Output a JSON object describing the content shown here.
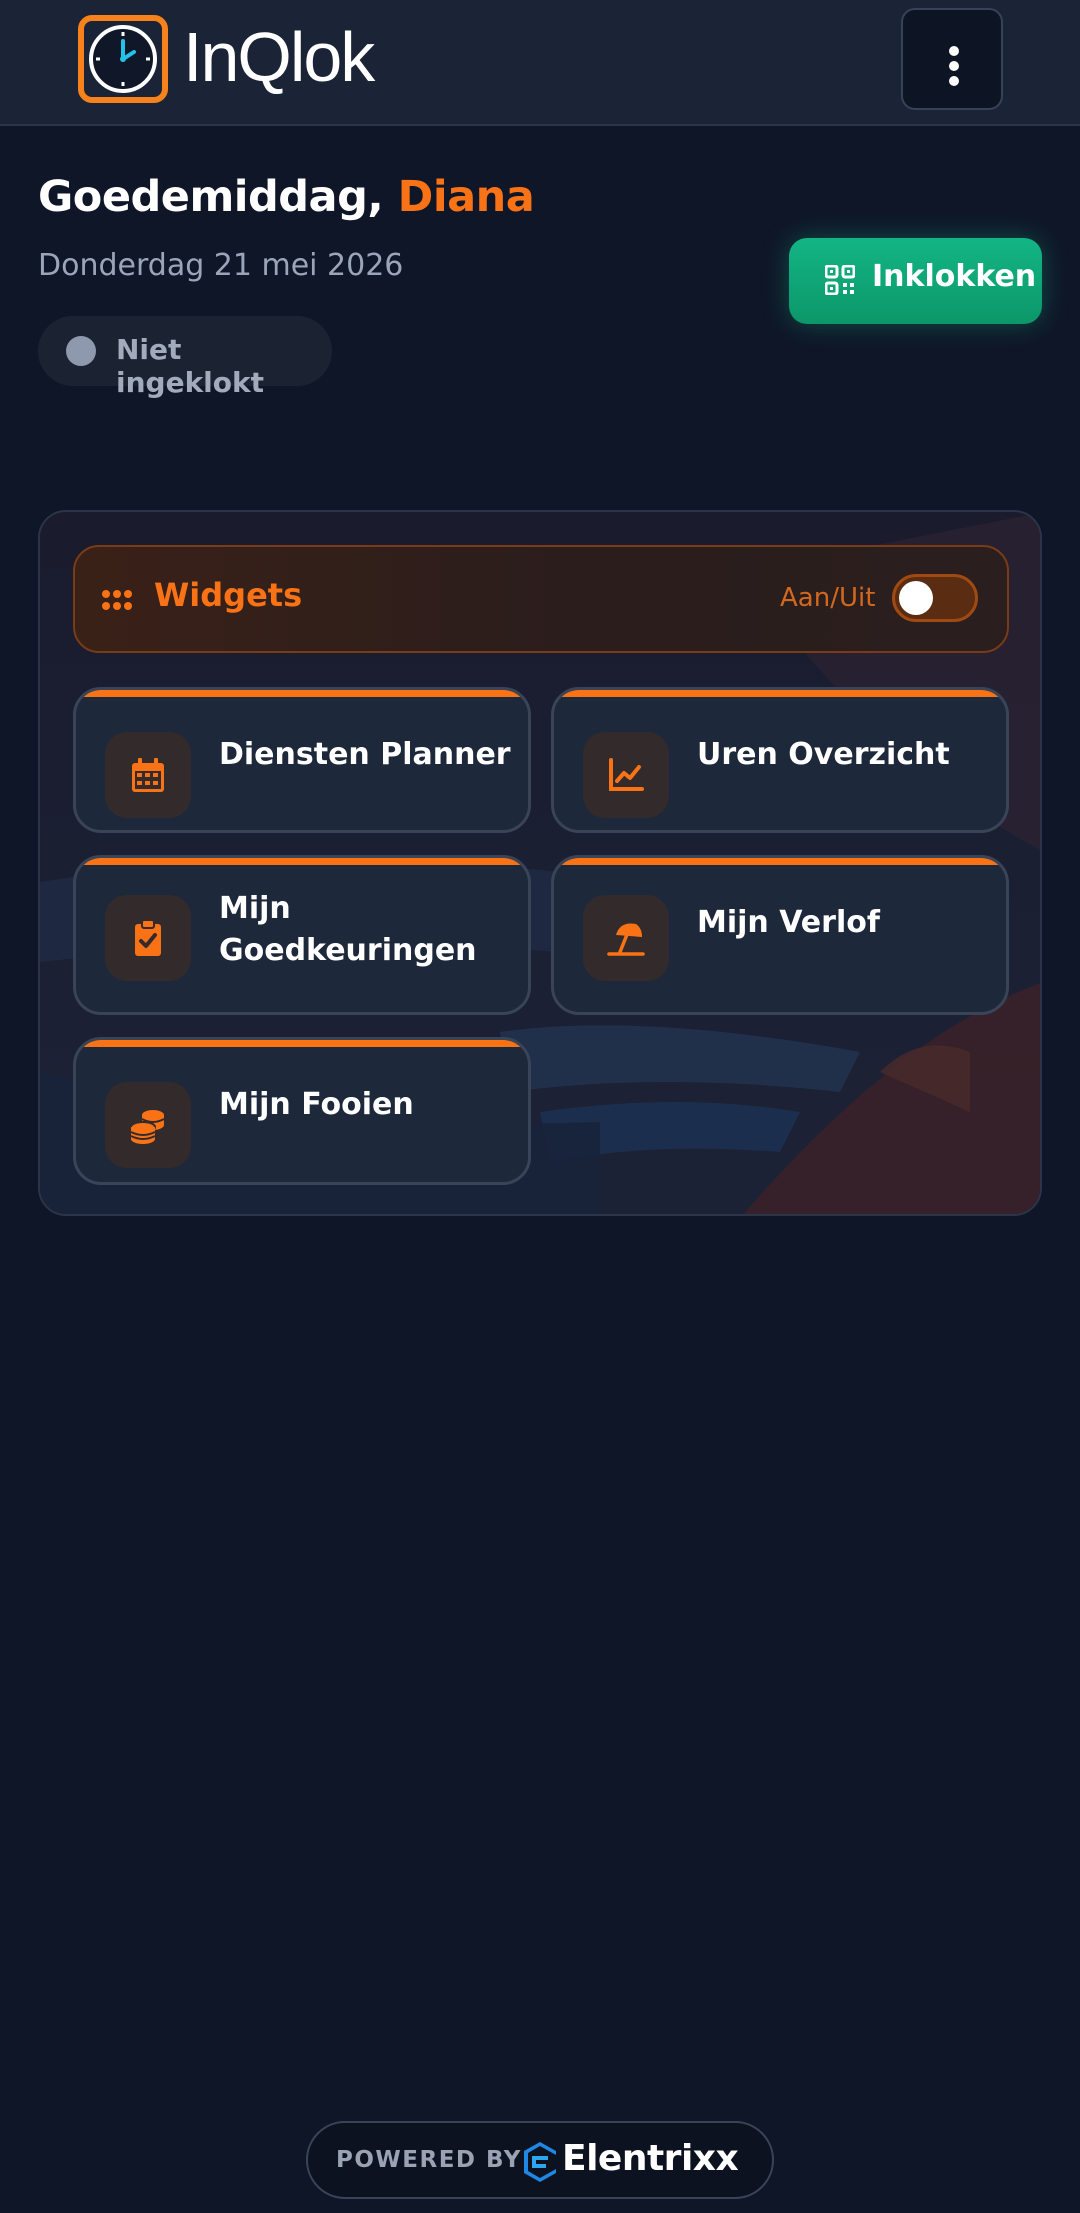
{
  "app": {
    "brand": "InQlok"
  },
  "greeting": {
    "salutation": "Goedemiddag,",
    "name": "Diana"
  },
  "date": "Donderdag 21 mei 2026",
  "status": {
    "label": "Niet ingeklokt"
  },
  "clockin": {
    "label": "Inklokken"
  },
  "widgets": {
    "title": "Widgets",
    "toggle_label": "Aan/Uit",
    "toggle_on": false,
    "tiles": [
      {
        "line1": "Diensten Planner",
        "line2": "",
        "icon": "calendar-icon"
      },
      {
        "line1": "Uren Overzicht",
        "line2": "",
        "icon": "chart-line-icon"
      },
      {
        "line1": "Mijn",
        "line2": "Goedkeuringen",
        "icon": "clipboard-check-icon"
      },
      {
        "line1": "Mijn Verlof",
        "line2": "",
        "icon": "beach-umbrella-icon"
      },
      {
        "line1": "Mijn Fooien",
        "line2": "",
        "icon": "coins-icon"
      }
    ]
  },
  "footer": {
    "powered_by": "POWERED BY",
    "company": "Elentrixx"
  },
  "colors": {
    "accent": "#f97316",
    "success": "#10b981",
    "background": "#0f1628"
  }
}
